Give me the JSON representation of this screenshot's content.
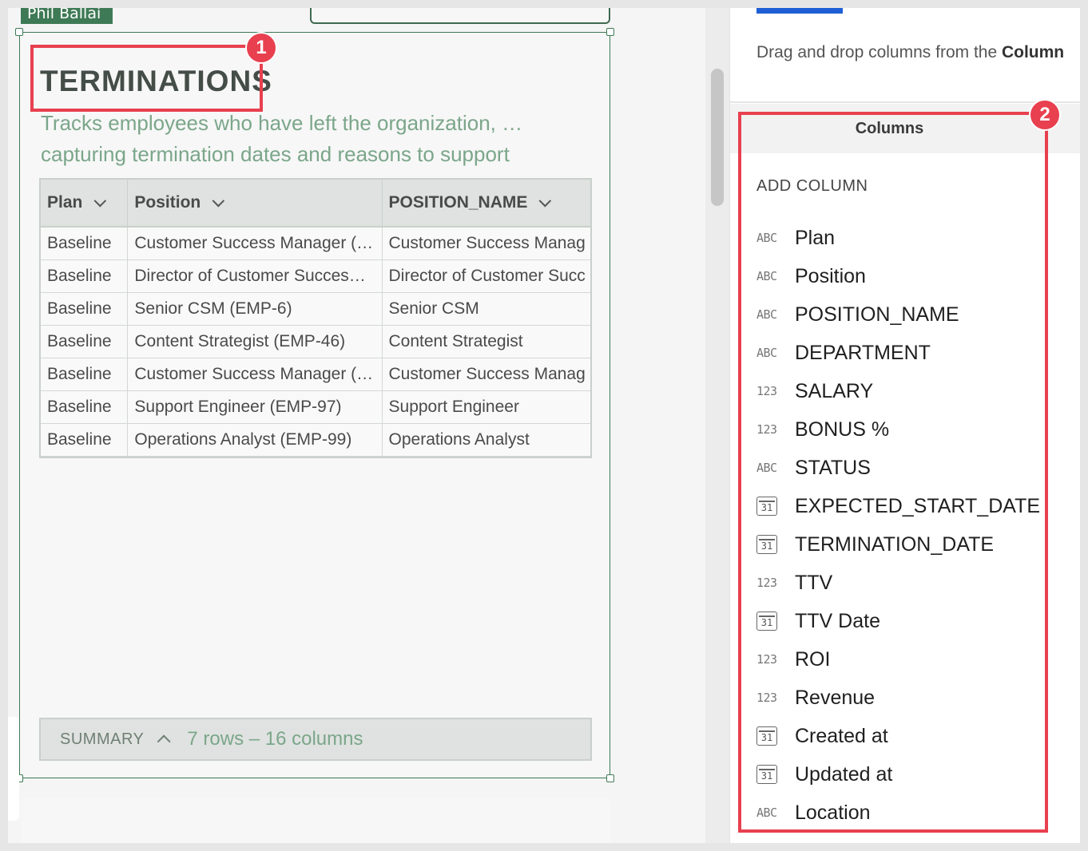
{
  "canvas": {
    "user_tag": "Phil Ballai"
  },
  "element": {
    "title": "TERMINATIONS",
    "description_line1": "Tracks employees who have left the organization, …",
    "description_line2": "capturing termination dates and reasons to support",
    "table": {
      "headers": [
        "Plan",
        "Position",
        "POSITION_NAME"
      ],
      "rows": [
        [
          "Baseline",
          "Customer Success Manager (…",
          "Customer Success Manag"
        ],
        [
          "Baseline",
          "Director of Customer Succes…",
          "Director of Customer Succ"
        ],
        [
          "Baseline",
          "Senior CSM (EMP-6)",
          "Senior CSM"
        ],
        [
          "Baseline",
          "Content Strategist (EMP-46)",
          "Content Strategist"
        ],
        [
          "Baseline",
          "Customer Success Manager (…",
          "Customer Success Manag"
        ],
        [
          "Baseline",
          "Support Engineer (EMP-97)",
          "Support Engineer"
        ],
        [
          "Baseline",
          "Operations Analyst (EMP-99)",
          "Operations Analyst"
        ]
      ]
    },
    "summary": {
      "label": "SUMMARY",
      "count": "7 rows – 16 columns"
    }
  },
  "panel": {
    "hint_prefix": "Drag and drop columns from the ",
    "hint_bold": "Column",
    "columns_title": "Columns",
    "add_column": "ADD COLUMN",
    "columns": [
      {
        "type": "ABC",
        "name": "Plan"
      },
      {
        "type": "ABC",
        "name": "Position"
      },
      {
        "type": "ABC",
        "name": "POSITION_NAME"
      },
      {
        "type": "ABC",
        "name": "DEPARTMENT"
      },
      {
        "type": "123",
        "name": "SALARY"
      },
      {
        "type": "123",
        "name": "BONUS %"
      },
      {
        "type": "ABC",
        "name": "STATUS"
      },
      {
        "type": "31",
        "name": "EXPECTED_START_DATE"
      },
      {
        "type": "31",
        "name": "TERMINATION_DATE"
      },
      {
        "type": "123",
        "name": "TTV"
      },
      {
        "type": "31",
        "name": "TTV Date"
      },
      {
        "type": "123",
        "name": "ROI"
      },
      {
        "type": "123",
        "name": "Revenue"
      },
      {
        "type": "31",
        "name": "Created at"
      },
      {
        "type": "31",
        "name": "Updated at"
      },
      {
        "type": "ABC",
        "name": "Location"
      }
    ]
  },
  "annotations": {
    "badge1": "1",
    "badge2": "2",
    "color": "#e8404f"
  }
}
